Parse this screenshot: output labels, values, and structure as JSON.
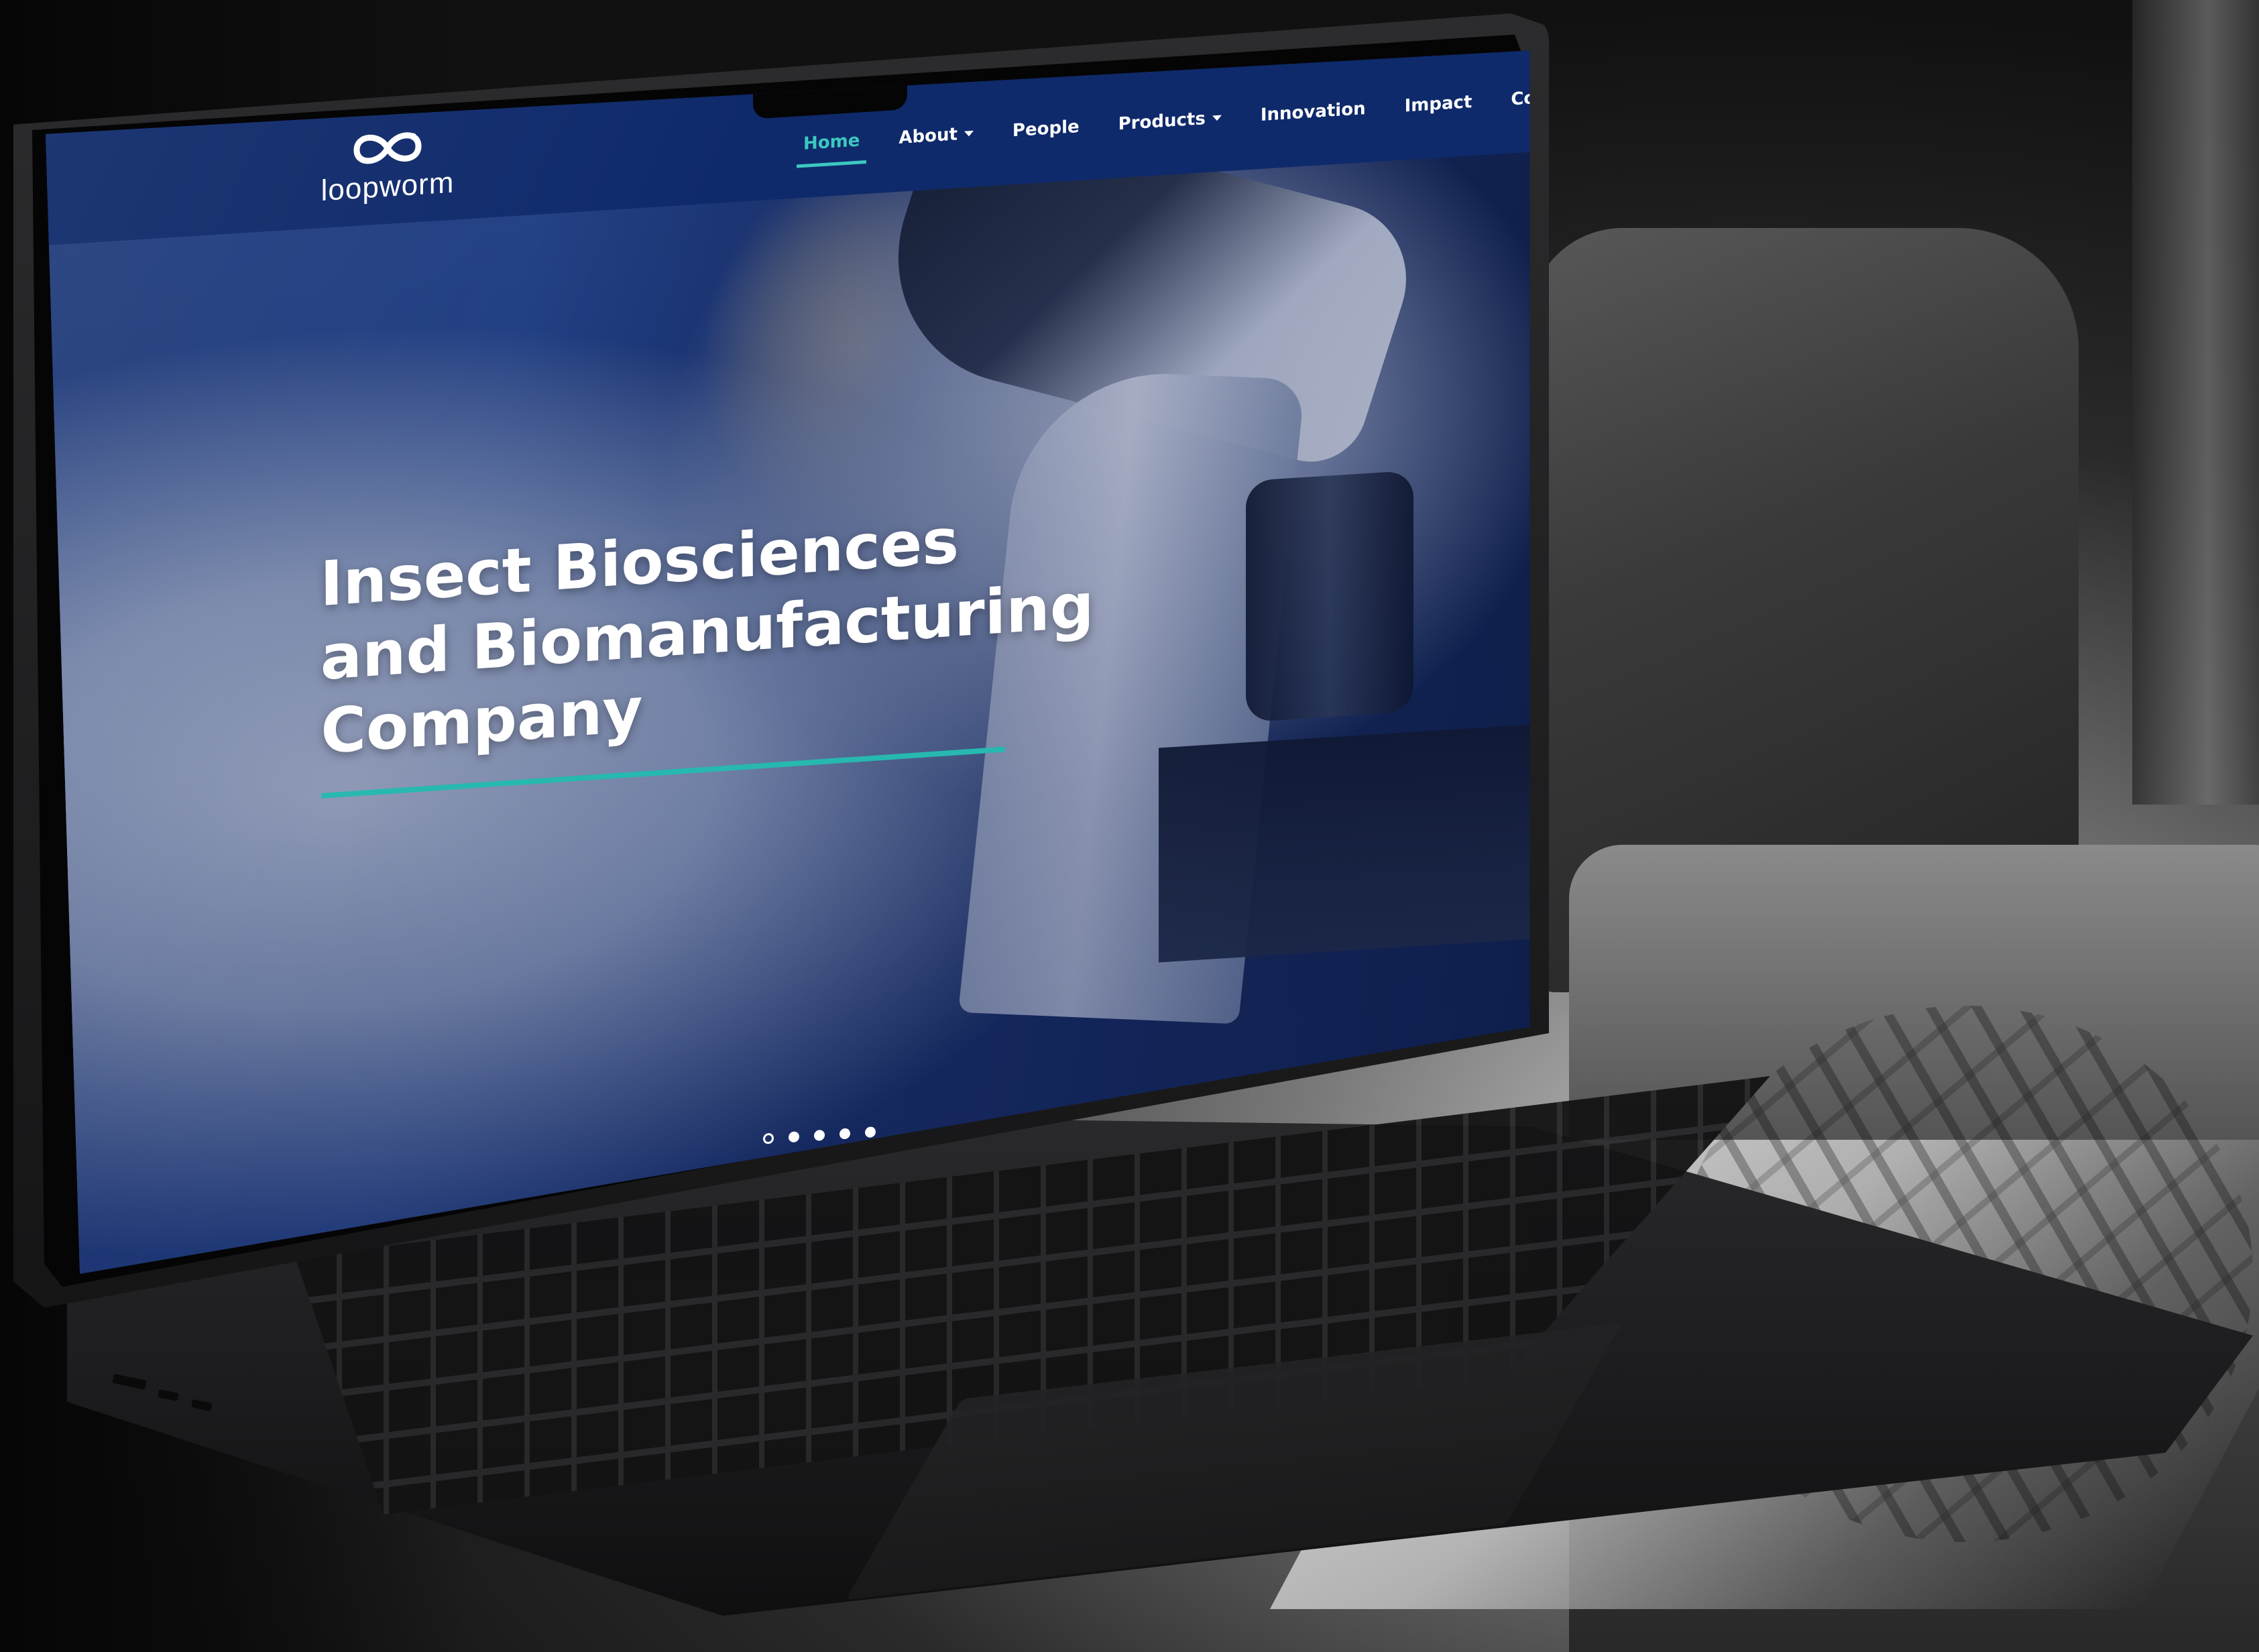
{
  "site": {
    "logo_text": "loopworm",
    "brand_colors": {
      "nav_bg": "#0f2a6b",
      "accent": "#3cc8c0",
      "hero_rule": "#27b8b0",
      "text": "#ffffff"
    }
  },
  "nav": {
    "items": [
      {
        "label": "Home",
        "active": true,
        "has_dropdown": false
      },
      {
        "label": "About",
        "active": false,
        "has_dropdown": true
      },
      {
        "label": "People",
        "active": false,
        "has_dropdown": false
      },
      {
        "label": "Products",
        "active": false,
        "has_dropdown": true
      },
      {
        "label": "Innovation",
        "active": false,
        "has_dropdown": false
      },
      {
        "label": "Impact",
        "active": false,
        "has_dropdown": false
      },
      {
        "label": "Contact Us",
        "active": false,
        "has_dropdown": false
      }
    ]
  },
  "hero": {
    "title_lines": [
      "Insect Biosciences",
      "and Biomanufacturing",
      "Company"
    ]
  },
  "carousel": {
    "slide_count": 5,
    "active_index": 0
  },
  "icons": {
    "logo": "infinity-loop-icon",
    "dropdown": "chevron-down-icon"
  }
}
